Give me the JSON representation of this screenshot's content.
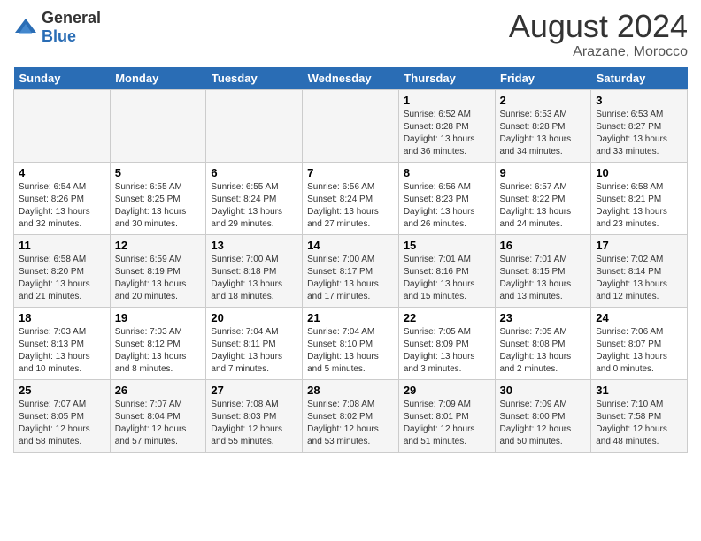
{
  "logo": {
    "general": "General",
    "blue": "Blue"
  },
  "title": {
    "month_year": "August 2024",
    "location": "Arazane, Morocco"
  },
  "weekdays": [
    "Sunday",
    "Monday",
    "Tuesday",
    "Wednesday",
    "Thursday",
    "Friday",
    "Saturday"
  ],
  "weeks": [
    [
      {
        "day": "",
        "info": ""
      },
      {
        "day": "",
        "info": ""
      },
      {
        "day": "",
        "info": ""
      },
      {
        "day": "",
        "info": ""
      },
      {
        "day": "1",
        "info": "Sunrise: 6:52 AM\nSunset: 8:28 PM\nDaylight: 13 hours and 36 minutes."
      },
      {
        "day": "2",
        "info": "Sunrise: 6:53 AM\nSunset: 8:28 PM\nDaylight: 13 hours and 34 minutes."
      },
      {
        "day": "3",
        "info": "Sunrise: 6:53 AM\nSunset: 8:27 PM\nDaylight: 13 hours and 33 minutes."
      }
    ],
    [
      {
        "day": "4",
        "info": "Sunrise: 6:54 AM\nSunset: 8:26 PM\nDaylight: 13 hours and 32 minutes."
      },
      {
        "day": "5",
        "info": "Sunrise: 6:55 AM\nSunset: 8:25 PM\nDaylight: 13 hours and 30 minutes."
      },
      {
        "day": "6",
        "info": "Sunrise: 6:55 AM\nSunset: 8:24 PM\nDaylight: 13 hours and 29 minutes."
      },
      {
        "day": "7",
        "info": "Sunrise: 6:56 AM\nSunset: 8:24 PM\nDaylight: 13 hours and 27 minutes."
      },
      {
        "day": "8",
        "info": "Sunrise: 6:56 AM\nSunset: 8:23 PM\nDaylight: 13 hours and 26 minutes."
      },
      {
        "day": "9",
        "info": "Sunrise: 6:57 AM\nSunset: 8:22 PM\nDaylight: 13 hours and 24 minutes."
      },
      {
        "day": "10",
        "info": "Sunrise: 6:58 AM\nSunset: 8:21 PM\nDaylight: 13 hours and 23 minutes."
      }
    ],
    [
      {
        "day": "11",
        "info": "Sunrise: 6:58 AM\nSunset: 8:20 PM\nDaylight: 13 hours and 21 minutes."
      },
      {
        "day": "12",
        "info": "Sunrise: 6:59 AM\nSunset: 8:19 PM\nDaylight: 13 hours and 20 minutes."
      },
      {
        "day": "13",
        "info": "Sunrise: 7:00 AM\nSunset: 8:18 PM\nDaylight: 13 hours and 18 minutes."
      },
      {
        "day": "14",
        "info": "Sunrise: 7:00 AM\nSunset: 8:17 PM\nDaylight: 13 hours and 17 minutes."
      },
      {
        "day": "15",
        "info": "Sunrise: 7:01 AM\nSunset: 8:16 PM\nDaylight: 13 hours and 15 minutes."
      },
      {
        "day": "16",
        "info": "Sunrise: 7:01 AM\nSunset: 8:15 PM\nDaylight: 13 hours and 13 minutes."
      },
      {
        "day": "17",
        "info": "Sunrise: 7:02 AM\nSunset: 8:14 PM\nDaylight: 13 hours and 12 minutes."
      }
    ],
    [
      {
        "day": "18",
        "info": "Sunrise: 7:03 AM\nSunset: 8:13 PM\nDaylight: 13 hours and 10 minutes."
      },
      {
        "day": "19",
        "info": "Sunrise: 7:03 AM\nSunset: 8:12 PM\nDaylight: 13 hours and 8 minutes."
      },
      {
        "day": "20",
        "info": "Sunrise: 7:04 AM\nSunset: 8:11 PM\nDaylight: 13 hours and 7 minutes."
      },
      {
        "day": "21",
        "info": "Sunrise: 7:04 AM\nSunset: 8:10 PM\nDaylight: 13 hours and 5 minutes."
      },
      {
        "day": "22",
        "info": "Sunrise: 7:05 AM\nSunset: 8:09 PM\nDaylight: 13 hours and 3 minutes."
      },
      {
        "day": "23",
        "info": "Sunrise: 7:05 AM\nSunset: 8:08 PM\nDaylight: 13 hours and 2 minutes."
      },
      {
        "day": "24",
        "info": "Sunrise: 7:06 AM\nSunset: 8:07 PM\nDaylight: 13 hours and 0 minutes."
      }
    ],
    [
      {
        "day": "25",
        "info": "Sunrise: 7:07 AM\nSunset: 8:05 PM\nDaylight: 12 hours and 58 minutes."
      },
      {
        "day": "26",
        "info": "Sunrise: 7:07 AM\nSunset: 8:04 PM\nDaylight: 12 hours and 57 minutes."
      },
      {
        "day": "27",
        "info": "Sunrise: 7:08 AM\nSunset: 8:03 PM\nDaylight: 12 hours and 55 minutes."
      },
      {
        "day": "28",
        "info": "Sunrise: 7:08 AM\nSunset: 8:02 PM\nDaylight: 12 hours and 53 minutes."
      },
      {
        "day": "29",
        "info": "Sunrise: 7:09 AM\nSunset: 8:01 PM\nDaylight: 12 hours and 51 minutes."
      },
      {
        "day": "30",
        "info": "Sunrise: 7:09 AM\nSunset: 8:00 PM\nDaylight: 12 hours and 50 minutes."
      },
      {
        "day": "31",
        "info": "Sunrise: 7:10 AM\nSunset: 7:58 PM\nDaylight: 12 hours and 48 minutes."
      }
    ]
  ]
}
